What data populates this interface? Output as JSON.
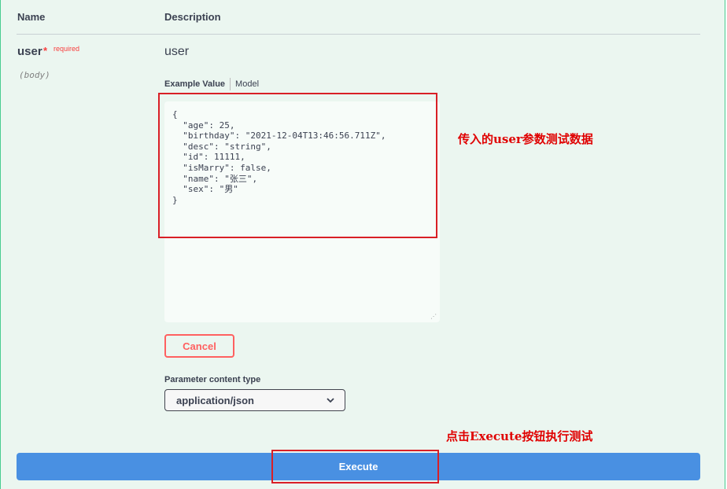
{
  "table_header": {
    "name_col": "Name",
    "description_col": "Description"
  },
  "parameter": {
    "name": "user",
    "required_star": "*",
    "required_text": "required",
    "location": "(body)",
    "description": "user"
  },
  "body_tabs": {
    "example_value": "Example Value",
    "model": "Model"
  },
  "request_body": "{\n  \"age\": 25,\n  \"birthday\": \"2021-12-04T13:46:56.711Z\",\n  \"desc\": \"string\",\n  \"id\": 11111,\n  \"isMarry\": false,\n  \"name\": \"张三\",\n  \"sex\": \"男\"\n}",
  "cancel_label": "Cancel",
  "content_type": {
    "label": "Parameter content type",
    "selected": "application/json"
  },
  "annotations": {
    "body_note": "传入的user参数测试数据",
    "execute_note": "点击Execute按钮执行测试"
  },
  "execute_label": "Execute",
  "colors": {
    "accent_green": "#49cc90",
    "execute_blue": "#4990e2",
    "cancel_red": "#ff6060",
    "annotation_red": "#d91f26"
  }
}
